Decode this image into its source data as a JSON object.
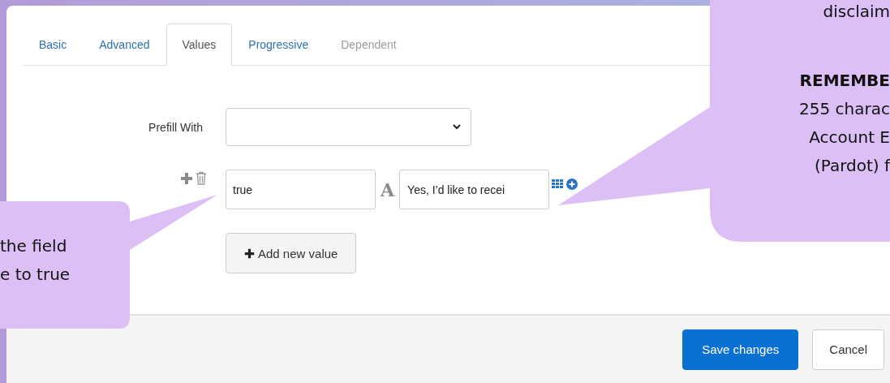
{
  "tabs": [
    {
      "label": "Basic",
      "selected": false,
      "disabled": false
    },
    {
      "label": "Advanced",
      "selected": false,
      "disabled": false
    },
    {
      "label": "Values",
      "selected": true,
      "disabled": false
    },
    {
      "label": "Progressive",
      "selected": false,
      "disabled": false
    },
    {
      "label": "Dependent",
      "selected": false,
      "disabled": true
    }
  ],
  "prefill": {
    "label": "Prefill With"
  },
  "values": [
    {
      "value": "true",
      "type_icon": "A",
      "label": "Yes, I’d like to recei"
    }
  ],
  "add_button": "Add new value",
  "footer_buttons": [
    {
      "label": "Save changes",
      "kind": "primary"
    },
    {
      "label": "Cancel",
      "kind": "secondary"
    }
  ],
  "left_callout": {
    "lines": [
      {
        "text": "the field",
        "bold": false
      },
      {
        "text": "e to true",
        "bold": false
      }
    ]
  },
  "right_callout": {
    "lines": [
      {
        "text": "disclaim",
        "bold": false
      },
      {
        "text": "REMEMBE",
        "bold": true
      },
      {
        "text": "255 charac",
        "bold": false
      },
      {
        "text": "Account E",
        "bold": false
      },
      {
        "text": "(Pardot) f",
        "bold": false
      }
    ]
  }
}
